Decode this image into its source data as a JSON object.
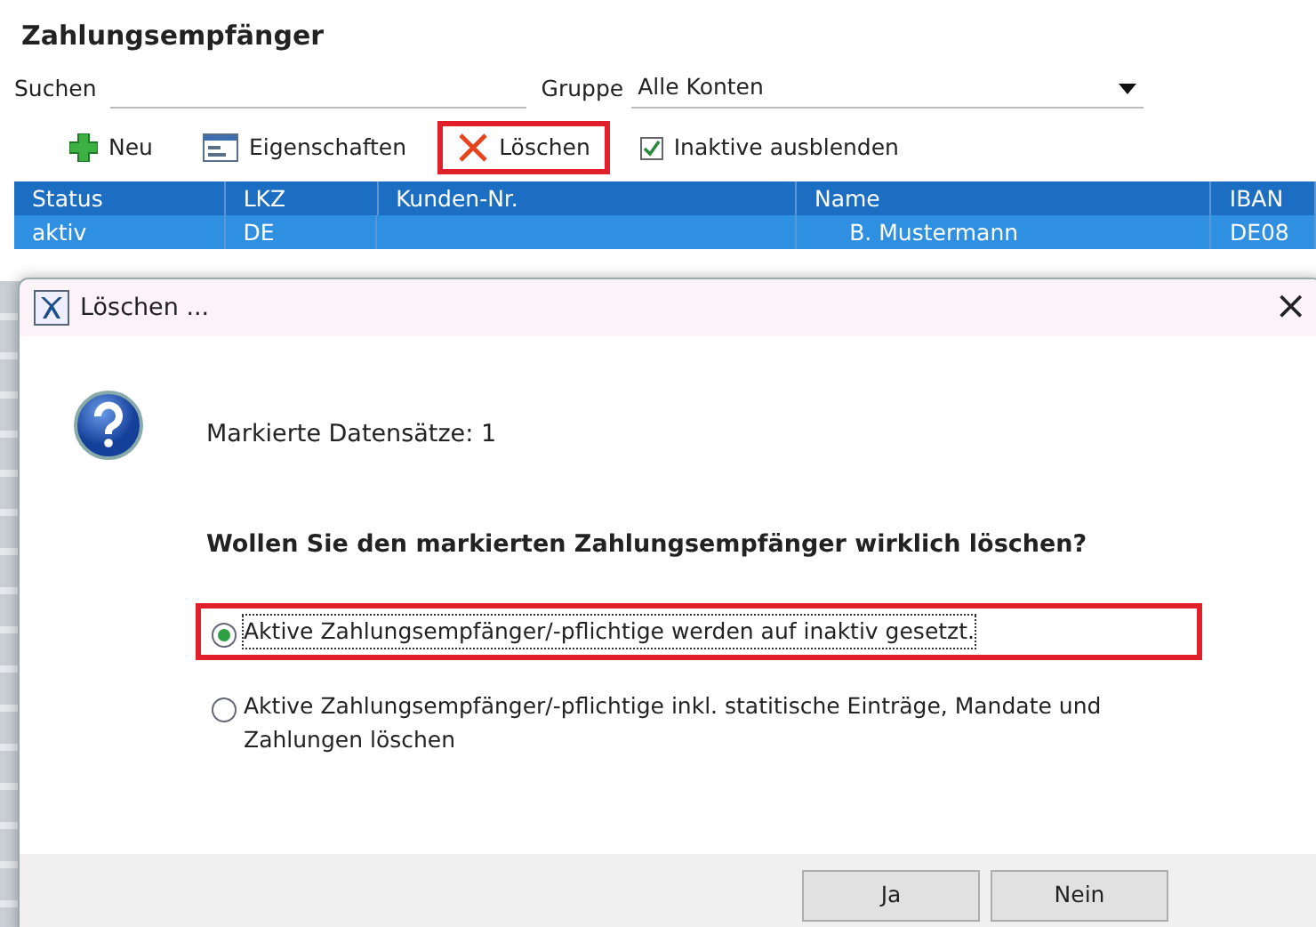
{
  "page": {
    "title": "Zahlungsempfänger"
  },
  "filters": {
    "search_label": "Suchen",
    "group_label": "Gruppe",
    "group_value": "Alle Konten"
  },
  "toolbar": [
    {
      "kind": "new",
      "label": "Neu",
      "highlighted": false
    },
    {
      "kind": "properties",
      "label": "Eigenschaften",
      "highlighted": false
    },
    {
      "kind": "delete",
      "label": "Löschen",
      "highlighted": true
    },
    {
      "kind": "checkbox",
      "label": "Inaktive ausblenden",
      "checked": true,
      "highlighted": false
    }
  ],
  "table": {
    "columns": [
      "Status",
      "LKZ",
      "Kunden-Nr.",
      "Name",
      "IBAN"
    ],
    "rows": [
      {
        "selected": true,
        "cells": [
          "aktiv",
          "DE",
          "",
          "B. Mustermann",
          "DE08"
        ]
      }
    ]
  },
  "dialog": {
    "title": "Löschen ...",
    "close": "×",
    "count_text": "Markierte Datensätze: 1",
    "question": "Wollen Sie den markierten Zahlungsempfänger wirklich löschen?",
    "options": [
      {
        "label": "Aktive Zahlungsempfänger/-pflichtige werden auf inaktiv gesetzt.",
        "selected": true,
        "highlighted": true
      },
      {
        "label": "Aktive Zahlungsempfänger/-pflichtige inkl. statitische Einträge, Mandate und Zahlungen löschen",
        "selected": false,
        "highlighted": false
      }
    ],
    "buttons": [
      "Ja",
      "Nein"
    ]
  }
}
